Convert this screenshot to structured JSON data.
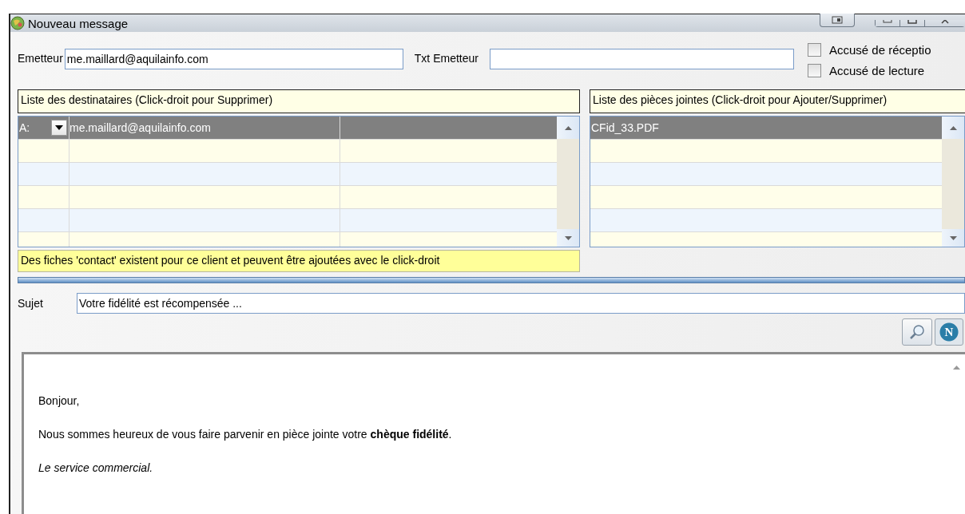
{
  "window": {
    "title": "Nouveau message"
  },
  "sender": {
    "label": "Emetteur",
    "value": "me.maillard@aquilainfo.com"
  },
  "sender_text": {
    "label": "Txt Emetteur"
  },
  "options": [
    {
      "label": "Accusé de réceptio",
      "checked": false
    },
    {
      "label": "Accusé de lecture",
      "checked": false
    }
  ],
  "recipients": {
    "header": "Liste des destinataires (Click-droit pour Supprimer)",
    "rows": [
      {
        "type": "A:",
        "address": "me.maillard@aquilainfo.com",
        "selected": true
      }
    ],
    "note": "Des fiches 'contact' existent pour ce client et peuvent être ajoutées avec le click-droit"
  },
  "attachments": {
    "header": "Liste des pièces jointes (Click-droit pour Ajouter/Supprimer)",
    "rows": [
      {
        "name": "CFid_33.PDF",
        "selected": true
      }
    ]
  },
  "subject": {
    "label": "Sujet",
    "value": "Votre fidélité est récompensée ..."
  },
  "toolbar": {
    "n_label": "N"
  },
  "body": [
    {
      "text": "Bonjour,",
      "kind": "plain"
    },
    {
      "text": "Nous sommes heureux de vous faire parvenir en pièce jointe votre **chèque fidélité**.",
      "kind": "plain"
    },
    {
      "text": "Le service commercial.",
      "kind": "signature"
    }
  ]
}
